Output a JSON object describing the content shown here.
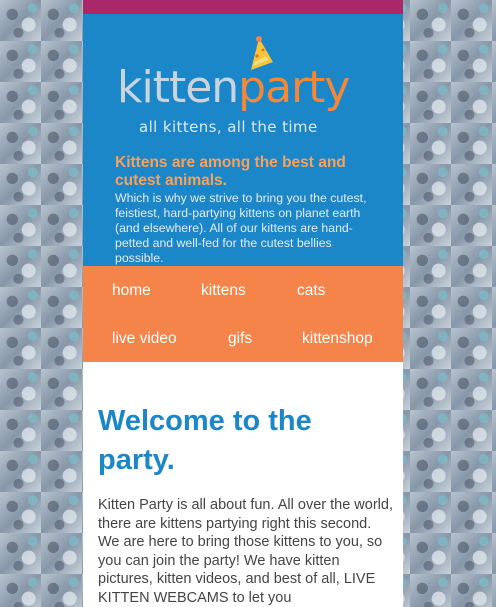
{
  "brand": {
    "logo_part1": "kitten",
    "logo_part2": "party",
    "tagline": "all kittens, all the time"
  },
  "intro": {
    "title": "Kittens are among the best and cutest animals.",
    "text": "Which is why we strive to bring you the cutest, feistiest, hard-partying kittens on planet earth (and elsewhere). All of our kittens are hand-petted and well-fed for the cutest bellies possible."
  },
  "nav": {
    "items": [
      {
        "label": "home"
      },
      {
        "label": "kittens"
      },
      {
        "label": "cats"
      },
      {
        "label": "live video"
      },
      {
        "label": "gifs"
      },
      {
        "label": "kittenshop"
      }
    ]
  },
  "main": {
    "heading": "Welcome to the party.",
    "body": "Kitten Party is all about fun. All over the world, there are kittens partying right this second. We are here to bring those kittens to you, so you can join the party! We have kitten pictures, kitten videos, and best of all, LIVE KITTEN WEBCAMS to let you"
  },
  "colors": {
    "accent_blue": "#1b86c8",
    "accent_orange": "#f4844a",
    "top_strip": "#a8286a"
  },
  "icons": {
    "party_hat": "party-hat-icon"
  }
}
